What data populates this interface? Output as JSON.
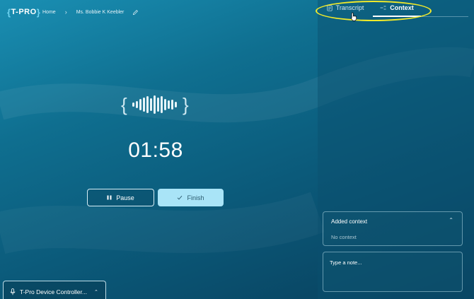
{
  "header": {
    "logo_text": "T-PRO",
    "breadcrumb": {
      "home": "Home",
      "patient": "Ms. Bobbie K Keebler"
    }
  },
  "recorder": {
    "timer": "01:58",
    "pause_label": "Pause",
    "finish_label": "Finish"
  },
  "device": {
    "label": "T-Pro Device Controller..."
  },
  "panel": {
    "tabs": [
      {
        "label": "Transcript",
        "active": false
      },
      {
        "label": "Context",
        "active": true
      }
    ],
    "added_context": {
      "title": "Added context",
      "empty_text": "No context"
    },
    "note": {
      "placeholder": "Type a note..."
    }
  },
  "colors": {
    "accent": "#a9e4f7",
    "highlight": "#f2ea2a",
    "background_top": "#1a8fb3",
    "background_bottom": "#083f5c"
  },
  "icons": [
    "edit-icon",
    "waveform-icon",
    "pause-icon",
    "check-icon",
    "microphone-icon",
    "chevron-up-icon",
    "transcript-icon",
    "context-icon",
    "pointer-cursor-icon"
  ]
}
